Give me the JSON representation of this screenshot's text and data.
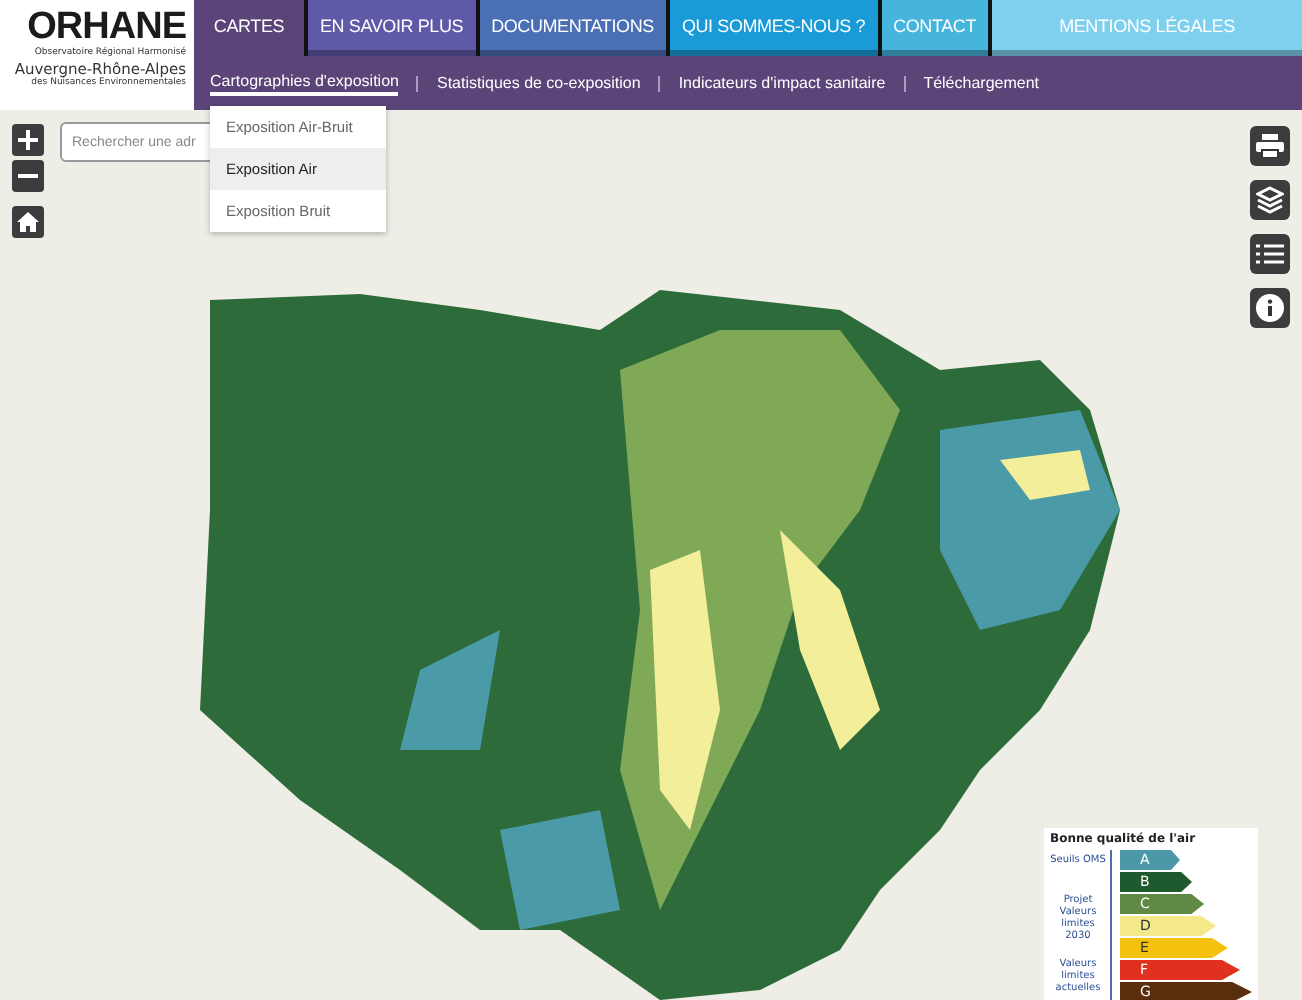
{
  "logo": {
    "name": "ORHANE",
    "subtitle": [
      "Observatoire Régional Harmonisé",
      "Auvergne-Rhône-Alpes",
      "des Nuisances Environnementales"
    ]
  },
  "tabs": [
    {
      "label": "CARTES",
      "selected": true,
      "color": "#5b4478"
    },
    {
      "label": "EN SAVOIR PLUS",
      "selected": false,
      "color": "#5f5aa8"
    },
    {
      "label": "DOCUMENTATIONS",
      "selected": false,
      "color": "#4b6fb5"
    },
    {
      "label": "QUI SOMMES-NOUS ?",
      "selected": false,
      "color": "#1a9bd7"
    },
    {
      "label": "CONTACT",
      "selected": false,
      "color": "#45b5dd"
    },
    {
      "label": "MENTIONS LÉGALES",
      "selected": false,
      "color": "#7fd0ee"
    }
  ],
  "submenu": [
    {
      "label": "Cartographies d'exposition",
      "selected": true
    },
    {
      "label": "Statistiques de co-exposition",
      "selected": false
    },
    {
      "label": "Indicateurs d'impact sanitaire",
      "selected": false
    },
    {
      "label": "Téléchargement",
      "selected": false
    }
  ],
  "dropdown": [
    {
      "label": "Exposition Air-Bruit",
      "selected": false
    },
    {
      "label": "Exposition Air",
      "selected": true
    },
    {
      "label": "Exposition Bruit",
      "selected": false
    }
  ],
  "search": {
    "placeholder": "Rechercher une adr"
  },
  "legend": {
    "title": "Bonne qualité de l'air",
    "notes": [
      {
        "text": "Seuils OMS"
      },
      {
        "text": "Projet Valeurs limites 2030"
      },
      {
        "text": "Valeurs limites actuelles"
      }
    ],
    "grades": [
      {
        "label": "A",
        "color": "#4a98a8"
      },
      {
        "label": "B",
        "color": "#1e5a2e"
      },
      {
        "label": "C",
        "color": "#5e8a45"
      },
      {
        "label": "D",
        "color": "#f3e98a"
      },
      {
        "label": "E",
        "color": "#f4c20d"
      },
      {
        "label": "F",
        "color": "#e0301e"
      },
      {
        "label": "G",
        "color": "#5a2d0c"
      }
    ]
  }
}
